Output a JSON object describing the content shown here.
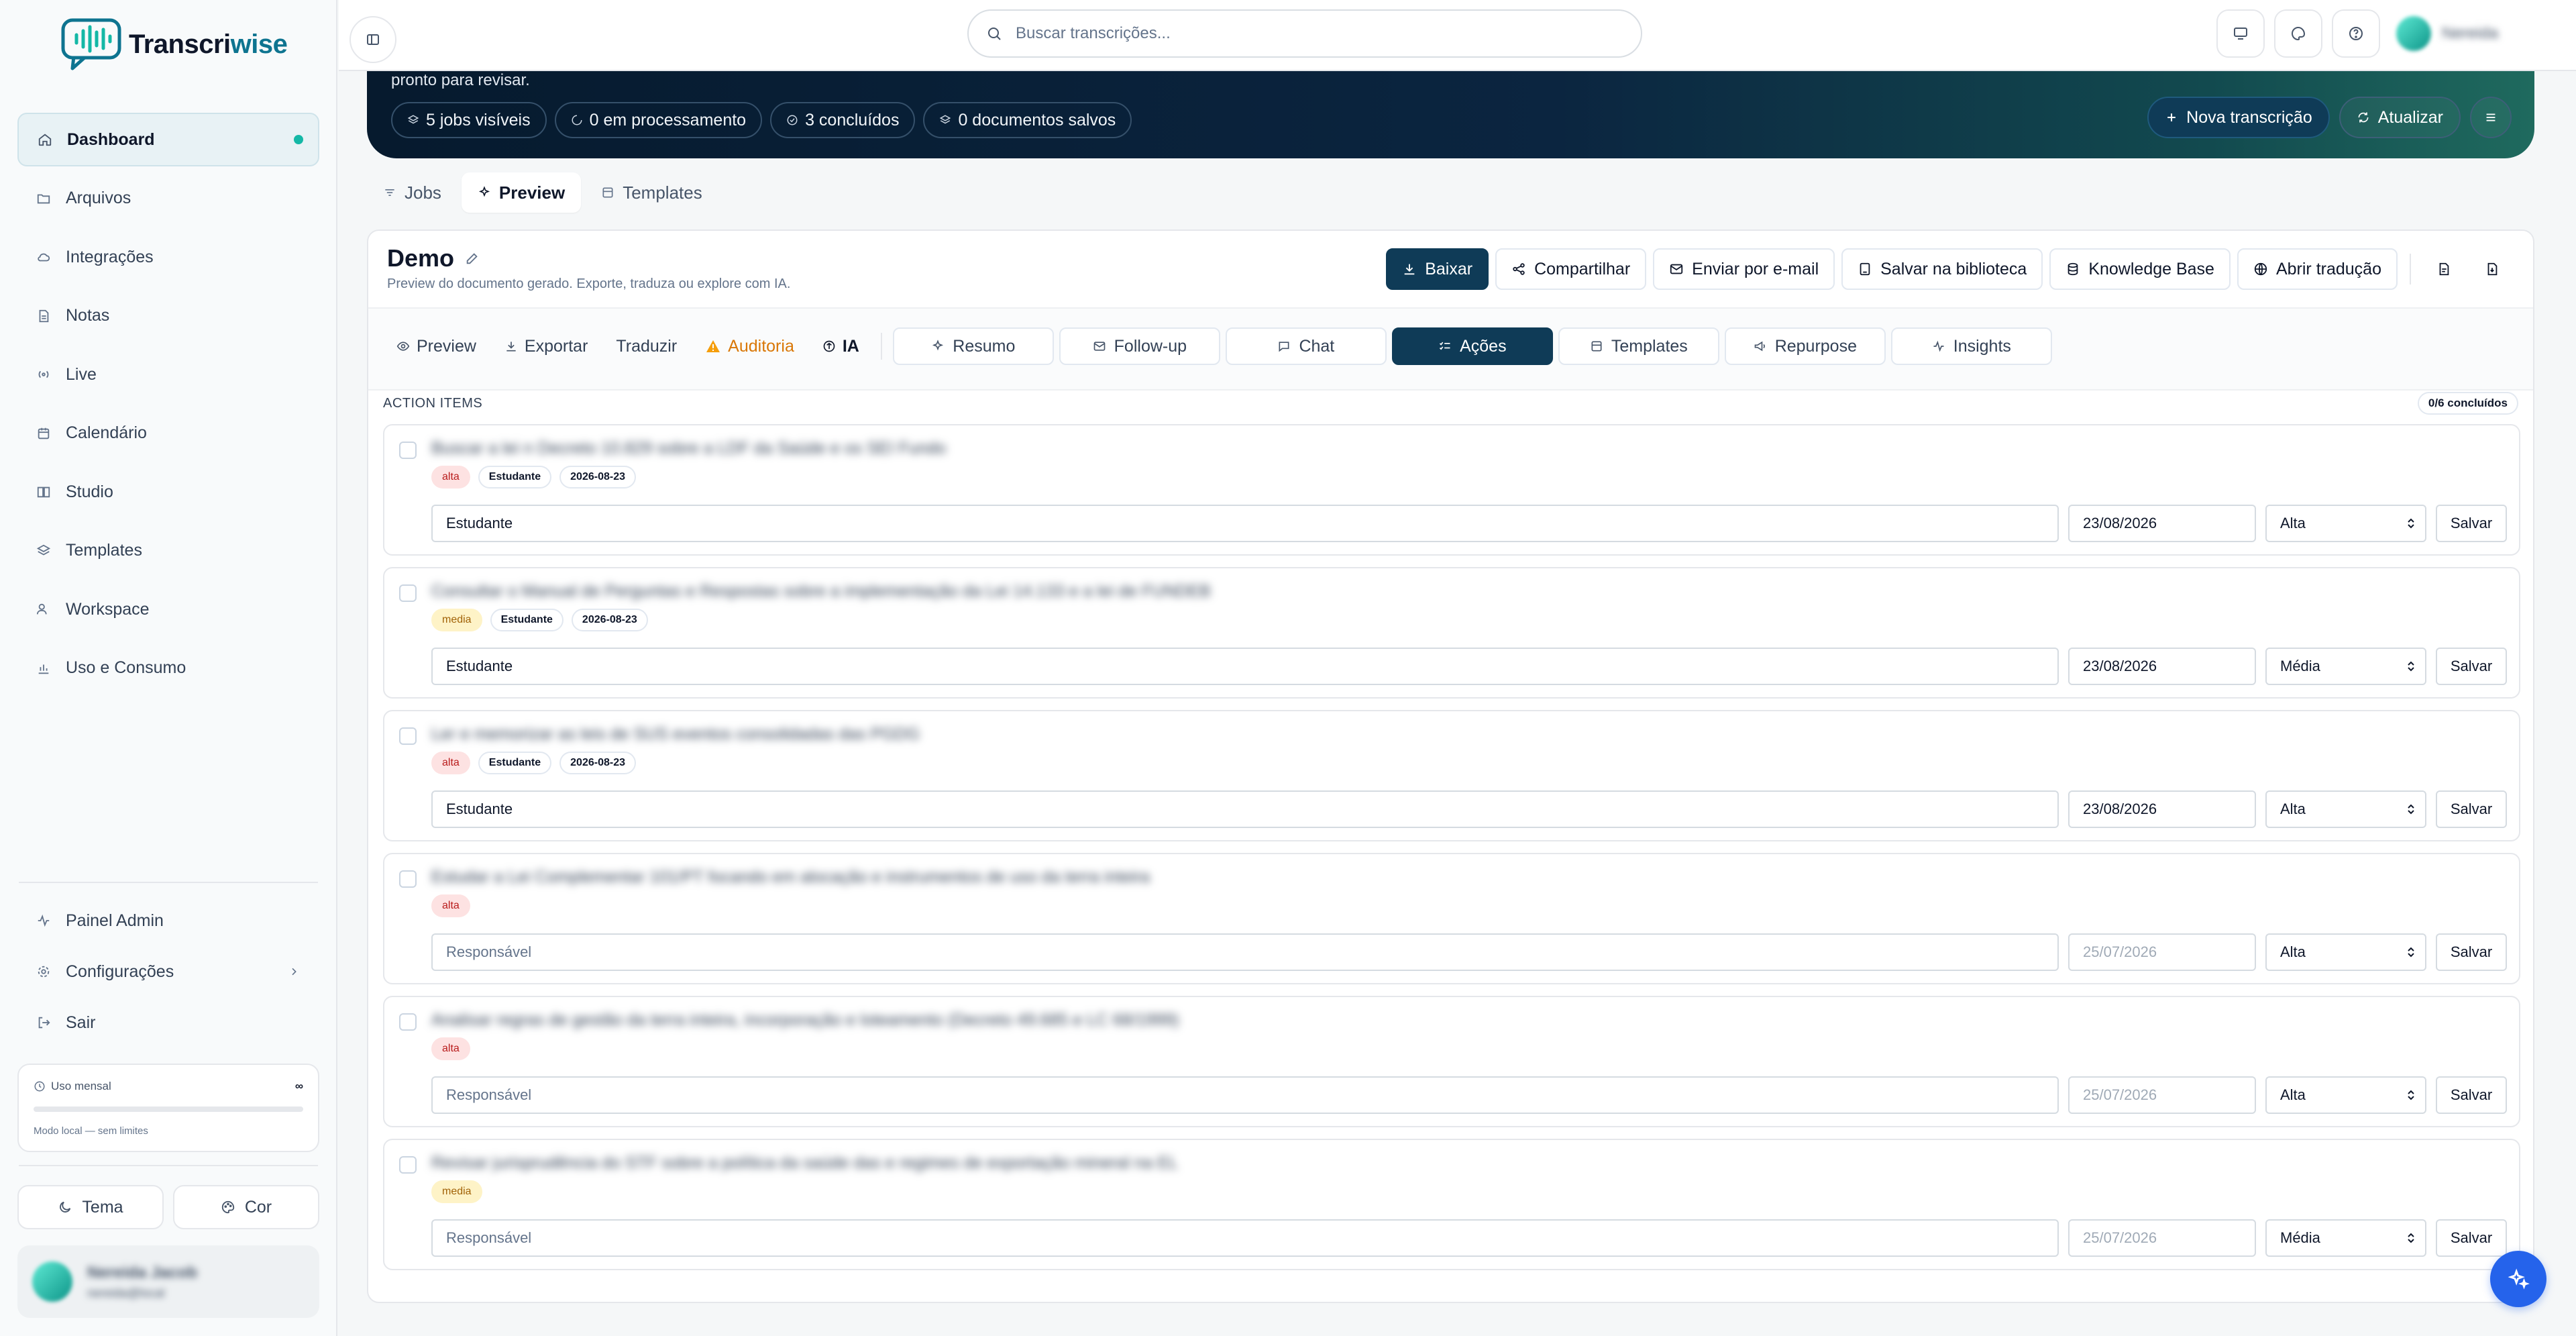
{
  "app": {
    "name_part1": "Transcri",
    "name_part2": "wise"
  },
  "sidebar": {
    "items": [
      {
        "label": "Dashboard",
        "icon": "home-icon"
      },
      {
        "label": "Arquivos",
        "icon": "folder-icon"
      },
      {
        "label": "Integrações",
        "icon": "cloud-icon"
      },
      {
        "label": "Notas",
        "icon": "file-icon"
      },
      {
        "label": "Live",
        "icon": "broadcast-icon"
      },
      {
        "label": "Calendário",
        "icon": "calendar-icon"
      },
      {
        "label": "Studio",
        "icon": "book-icon"
      },
      {
        "label": "Templates",
        "icon": "layers-icon"
      },
      {
        "label": "Workspace",
        "icon": "users-icon"
      },
      {
        "label": "Uso e Consumo",
        "icon": "bar-chart-icon"
      }
    ],
    "bottom": {
      "admin": "Painel Admin",
      "settings": "Configurações",
      "logout": "Sair"
    },
    "usage": {
      "label": "Uso mensal",
      "value": "∞",
      "footnote": "Modo local — sem limites"
    },
    "theme_btn": "Tema",
    "color_btn": "Cor",
    "profile": {
      "name": "Nereida Jacob",
      "email": "nereida@local"
    }
  },
  "topbar": {
    "search_placeholder": "Buscar transcrições...",
    "user_name": "Nereida"
  },
  "hero": {
    "subtitle": "pronto para revisar.",
    "chips": [
      "5 jobs visíveis",
      "0 em processamento",
      "3 concluídos",
      "0 documentos salvos"
    ],
    "new_btn": "Nova transcrição",
    "refresh_btn": "Atualizar"
  },
  "tabs": [
    "Jobs",
    "Preview",
    "Templates"
  ],
  "document": {
    "title": "Demo",
    "subtitle": "Preview do documento gerado. Exporte, traduza ou explore com IA.",
    "actions": [
      "Baixar",
      "Compartilhar",
      "Enviar por e-mail",
      "Salvar na biblioteca",
      "Knowledge Base",
      "Abrir tradução"
    ],
    "subtabs_plain": [
      "Preview",
      "Exportar",
      "Traduzir",
      "Auditoria",
      "IA"
    ],
    "subtabs_boxed": [
      "Resumo",
      "Follow-up",
      "Chat",
      "Ações",
      "Templates",
      "Repurpose",
      "Insights"
    ],
    "active_subtab": "Ações"
  },
  "action_items": {
    "header": "ACTION ITEMS",
    "count": "0/6 concluídos",
    "save_label": "Salvar",
    "responsible_placeholder": "Responsável",
    "items": [
      {
        "title": "Buscar a lei n Decreto 10.829 sobre a LDF da Saúde e os SEI Fundo",
        "priority_tag": "alta",
        "owner_tag": "Estudante",
        "date_tag": "2026-08-23",
        "responsible": "Estudante",
        "date": "23/08/2026",
        "priority": "Alta"
      },
      {
        "title": "Consultar o Manual de Perguntas e Respostas sobre a implementação da Lei 14.133 e a lei de FUNDEB",
        "priority_tag": "media",
        "owner_tag": "Estudante",
        "date_tag": "2026-08-23",
        "responsible": "Estudante",
        "date": "23/08/2026",
        "priority": "Média"
      },
      {
        "title": "Ler e memorizar as leis de SUS eventos consolidadas das PGDG",
        "priority_tag": "alta",
        "owner_tag": "Estudante",
        "date_tag": "2026-08-23",
        "responsible": "Estudante",
        "date": "23/08/2026",
        "priority": "Alta"
      },
      {
        "title": "Estudar a Lei Complementar 101/PT focando em alocação e instrumentos de uso da terra inteira",
        "priority_tag": "alta",
        "owner_tag": "",
        "date_tag": "",
        "responsible": "",
        "date": "25/07/2026",
        "priority": "Alta"
      },
      {
        "title": "Analisar regras de gestão da terra inteira, incorporação e loteamento (Decreto 49.685 e LC 68/1999)",
        "priority_tag": "alta",
        "owner_tag": "",
        "date_tag": "",
        "responsible": "",
        "date": "25/07/2026",
        "priority": "Alta"
      },
      {
        "title": "Revisar jurisprudência do STF sobre a política da saúde das e regimes de exportação mineral na EL",
        "priority_tag": "media",
        "owner_tag": "",
        "date_tag": "",
        "responsible": "",
        "date": "25/07/2026",
        "priority": "Média"
      }
    ]
  },
  "colors": {
    "primary": "#0f3b57",
    "accent": "#14b8a6",
    "fab": "#2563eb",
    "alta": "#b91c1c",
    "media": "#a16207"
  }
}
